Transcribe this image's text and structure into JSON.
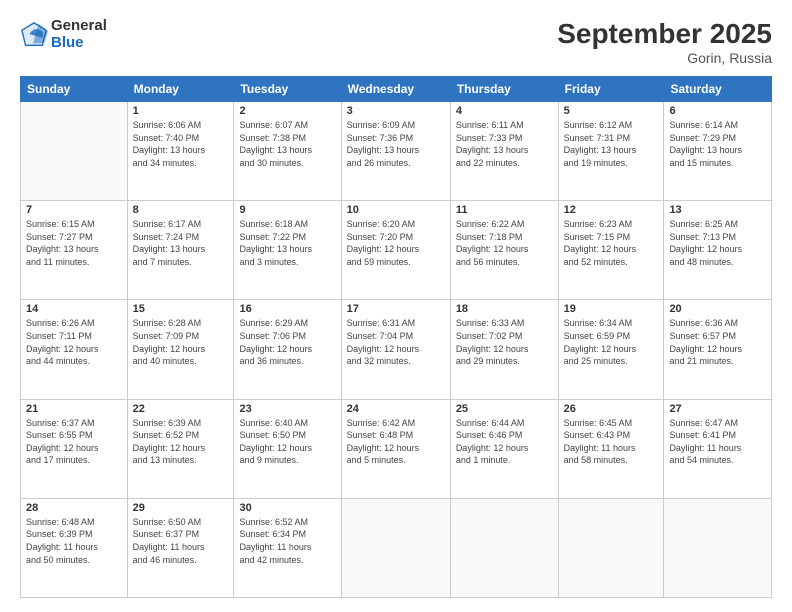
{
  "logo": {
    "general": "General",
    "blue": "Blue"
  },
  "header": {
    "title": "September 2025",
    "subtitle": "Gorin, Russia"
  },
  "days_of_week": [
    "Sunday",
    "Monday",
    "Tuesday",
    "Wednesday",
    "Thursday",
    "Friday",
    "Saturday"
  ],
  "weeks": [
    [
      {
        "day": "",
        "info": ""
      },
      {
        "day": "1",
        "info": "Sunrise: 6:06 AM\nSunset: 7:40 PM\nDaylight: 13 hours\nand 34 minutes."
      },
      {
        "day": "2",
        "info": "Sunrise: 6:07 AM\nSunset: 7:38 PM\nDaylight: 13 hours\nand 30 minutes."
      },
      {
        "day": "3",
        "info": "Sunrise: 6:09 AM\nSunset: 7:36 PM\nDaylight: 13 hours\nand 26 minutes."
      },
      {
        "day": "4",
        "info": "Sunrise: 6:11 AM\nSunset: 7:33 PM\nDaylight: 13 hours\nand 22 minutes."
      },
      {
        "day": "5",
        "info": "Sunrise: 6:12 AM\nSunset: 7:31 PM\nDaylight: 13 hours\nand 19 minutes."
      },
      {
        "day": "6",
        "info": "Sunrise: 6:14 AM\nSunset: 7:29 PM\nDaylight: 13 hours\nand 15 minutes."
      }
    ],
    [
      {
        "day": "7",
        "info": "Sunrise: 6:15 AM\nSunset: 7:27 PM\nDaylight: 13 hours\nand 11 minutes."
      },
      {
        "day": "8",
        "info": "Sunrise: 6:17 AM\nSunset: 7:24 PM\nDaylight: 13 hours\nand 7 minutes."
      },
      {
        "day": "9",
        "info": "Sunrise: 6:18 AM\nSunset: 7:22 PM\nDaylight: 13 hours\nand 3 minutes."
      },
      {
        "day": "10",
        "info": "Sunrise: 6:20 AM\nSunset: 7:20 PM\nDaylight: 12 hours\nand 59 minutes."
      },
      {
        "day": "11",
        "info": "Sunrise: 6:22 AM\nSunset: 7:18 PM\nDaylight: 12 hours\nand 56 minutes."
      },
      {
        "day": "12",
        "info": "Sunrise: 6:23 AM\nSunset: 7:15 PM\nDaylight: 12 hours\nand 52 minutes."
      },
      {
        "day": "13",
        "info": "Sunrise: 6:25 AM\nSunset: 7:13 PM\nDaylight: 12 hours\nand 48 minutes."
      }
    ],
    [
      {
        "day": "14",
        "info": "Sunrise: 6:26 AM\nSunset: 7:11 PM\nDaylight: 12 hours\nand 44 minutes."
      },
      {
        "day": "15",
        "info": "Sunrise: 6:28 AM\nSunset: 7:09 PM\nDaylight: 12 hours\nand 40 minutes."
      },
      {
        "day": "16",
        "info": "Sunrise: 6:29 AM\nSunset: 7:06 PM\nDaylight: 12 hours\nand 36 minutes."
      },
      {
        "day": "17",
        "info": "Sunrise: 6:31 AM\nSunset: 7:04 PM\nDaylight: 12 hours\nand 32 minutes."
      },
      {
        "day": "18",
        "info": "Sunrise: 6:33 AM\nSunset: 7:02 PM\nDaylight: 12 hours\nand 29 minutes."
      },
      {
        "day": "19",
        "info": "Sunrise: 6:34 AM\nSunset: 6:59 PM\nDaylight: 12 hours\nand 25 minutes."
      },
      {
        "day": "20",
        "info": "Sunrise: 6:36 AM\nSunset: 6:57 PM\nDaylight: 12 hours\nand 21 minutes."
      }
    ],
    [
      {
        "day": "21",
        "info": "Sunrise: 6:37 AM\nSunset: 6:55 PM\nDaylight: 12 hours\nand 17 minutes."
      },
      {
        "day": "22",
        "info": "Sunrise: 6:39 AM\nSunset: 6:52 PM\nDaylight: 12 hours\nand 13 minutes."
      },
      {
        "day": "23",
        "info": "Sunrise: 6:40 AM\nSunset: 6:50 PM\nDaylight: 12 hours\nand 9 minutes."
      },
      {
        "day": "24",
        "info": "Sunrise: 6:42 AM\nSunset: 6:48 PM\nDaylight: 12 hours\nand 5 minutes."
      },
      {
        "day": "25",
        "info": "Sunrise: 6:44 AM\nSunset: 6:46 PM\nDaylight: 12 hours\nand 1 minute."
      },
      {
        "day": "26",
        "info": "Sunrise: 6:45 AM\nSunset: 6:43 PM\nDaylight: 11 hours\nand 58 minutes."
      },
      {
        "day": "27",
        "info": "Sunrise: 6:47 AM\nSunset: 6:41 PM\nDaylight: 11 hours\nand 54 minutes."
      }
    ],
    [
      {
        "day": "28",
        "info": "Sunrise: 6:48 AM\nSunset: 6:39 PM\nDaylight: 11 hours\nand 50 minutes."
      },
      {
        "day": "29",
        "info": "Sunrise: 6:50 AM\nSunset: 6:37 PM\nDaylight: 11 hours\nand 46 minutes."
      },
      {
        "day": "30",
        "info": "Sunrise: 6:52 AM\nSunset: 6:34 PM\nDaylight: 11 hours\nand 42 minutes."
      },
      {
        "day": "",
        "info": ""
      },
      {
        "day": "",
        "info": ""
      },
      {
        "day": "",
        "info": ""
      },
      {
        "day": "",
        "info": ""
      }
    ]
  ]
}
